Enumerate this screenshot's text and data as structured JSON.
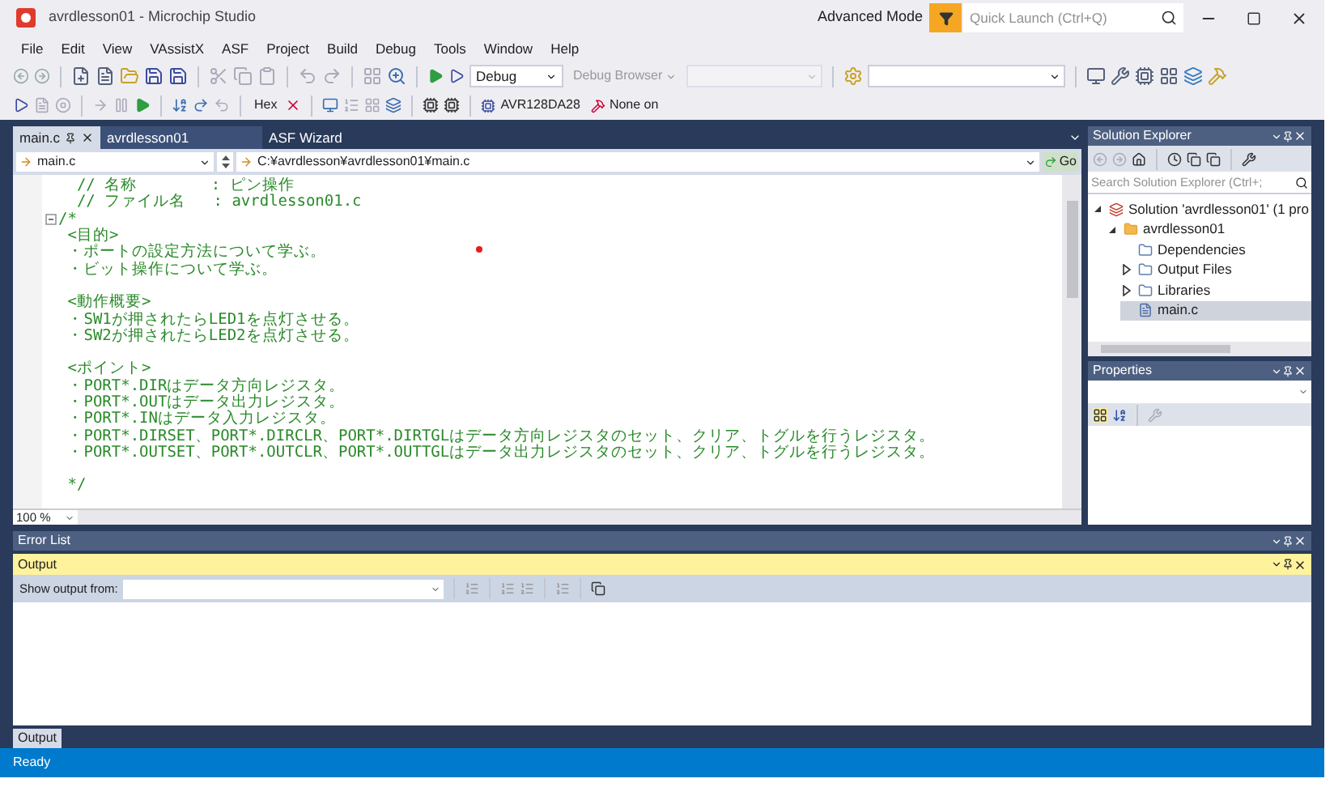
{
  "window": {
    "title": "avrdlesson01 - Microchip Studio",
    "mode": "Advanced Mode",
    "quick_launch": {
      "placeholder": "Quick Launch (Ctrl+Q)"
    }
  },
  "menu": [
    "File",
    "Edit",
    "View",
    "VAssistX",
    "ASF",
    "Project",
    "Build",
    "Debug",
    "Tools",
    "Window",
    "Help"
  ],
  "toolbar": {
    "configuration": "Debug",
    "debug_browser": "Debug Browser",
    "hex": "Hex",
    "device": "AVR128DA28",
    "tool": "None on"
  },
  "editor": {
    "tabs": [
      {
        "label": "main.c",
        "selected": true
      },
      {
        "label": "avrdlesson01",
        "selected": false
      },
      {
        "label": "ASF Wizard",
        "selected": false
      }
    ],
    "scope": "main.c",
    "path": "C:¥avrdlesson¥avrdlesson01¥main.c",
    "go": "Go",
    "lines": [
      {
        "text": "  // 名称        : ピン操作",
        "fold": false
      },
      {
        "text": "  // ファイル名   : avrdlesson01.c",
        "fold": false
      },
      {
        "text": "/*",
        "fold": true
      },
      {
        "text": " <目的>",
        "fold": false
      },
      {
        "text": " ・ポートの設定方法について学ぶ。",
        "fold": false
      },
      {
        "text": " ・ビット操作について学ぶ。",
        "fold": false
      },
      {
        "fold": false
      },
      {
        "text": " <動作概要>",
        "fold": false
      },
      {
        "text": " ・SW1が押されたらLED1を点灯させる。",
        "fold": false
      },
      {
        "text": " ・SW2が押されたらLED2を点灯させる。",
        "fold": false
      },
      {
        "fold": false
      },
      {
        "text": " <ポイント>",
        "fold": false
      },
      {
        "text": " ・PORT*.DIRはデータ方向レジスタ。",
        "fold": false
      },
      {
        "text": " ・PORT*.OUTはデータ出力レジスタ。",
        "fold": false
      },
      {
        "text": " ・PORT*.INはデータ入力レジスタ。",
        "fold": false
      },
      {
        "text": " ・PORT*.DIRSET、PORT*.DIRCLR、PORT*.DIRTGLはデータ方向レジスタのセット、クリア、トグルを行うレジスタ。",
        "fold": false
      },
      {
        "text": " ・PORT*.OUTSET、PORT*.OUTCLR、PORT*.OUTTGLはデータ出力レジスタのセット、クリア、トグルを行うレジスタ。",
        "fold": false
      },
      {
        "fold": false
      },
      {
        "text": " */",
        "fold": false
      }
    ],
    "zoom": "100 %"
  },
  "solution_explorer": {
    "title": "Solution Explorer",
    "search": {
      "placeholder": "Search Solution Explorer (Ctrl+;"
    },
    "tree": [
      {
        "label": "Solution 'avrdlesson01' (1 pro",
        "kind": "solution",
        "selected": false,
        "expanded": true,
        "children": [
          {
            "label": "avrdlesson01",
            "kind": "project",
            "selected": false,
            "expanded": true,
            "children": [
              {
                "label": "Dependencies",
                "kind": "folder",
                "selected": false
              },
              {
                "label": "Output Files",
                "kind": "folder",
                "selected": false,
                "expanded": false
              },
              {
                "label": "Libraries",
                "kind": "folder",
                "selected": false,
                "expanded": false
              },
              {
                "label": "main.c",
                "kind": "file",
                "selected": true
              }
            ]
          }
        ]
      }
    ]
  },
  "properties": {
    "title": "Properties"
  },
  "error_list": {
    "title": "Error List"
  },
  "output": {
    "title": "Output",
    "show_output_from": "Show output from:"
  },
  "bottom_tabs": [
    {
      "label": "Output"
    }
  ],
  "status_bar": {
    "text": "Ready"
  }
}
